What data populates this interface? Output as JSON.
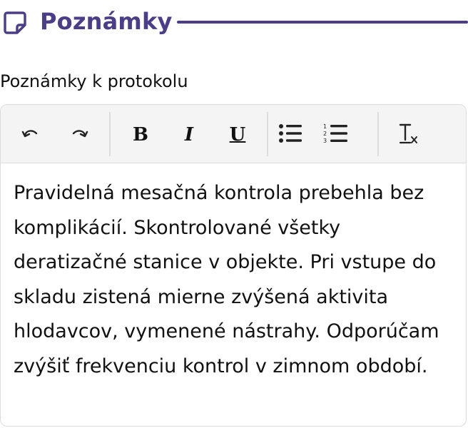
{
  "section": {
    "title": "Poznámky",
    "icon": "note-icon",
    "accent_color": "#4b3d86"
  },
  "field": {
    "label": "Poznámky k protokolu"
  },
  "toolbar": {
    "buttons": [
      {
        "name": "undo",
        "icon": "undo-icon"
      },
      {
        "name": "redo",
        "icon": "redo-icon"
      },
      {
        "name": "bold",
        "label": "B"
      },
      {
        "name": "italic",
        "label": "I"
      },
      {
        "name": "underline",
        "label": "U"
      },
      {
        "name": "bullet-list",
        "icon": "bullet-list-icon"
      },
      {
        "name": "numbered-list",
        "icon": "numbered-list-icon"
      },
      {
        "name": "clear-formatting",
        "icon": "clear-formatting-icon"
      }
    ]
  },
  "editor": {
    "content": "Pravidelná mesačná kontrola prebehla bez komplikácií. Skontrolované všetky deratizačné stanice v objekte. Pri vstupe do skladu zistená mierne zvýšená aktivita hlodavcov, vymenené nástrahy. Odporúčam zvýšiť frekvenciu kontrol v zimnom období."
  }
}
